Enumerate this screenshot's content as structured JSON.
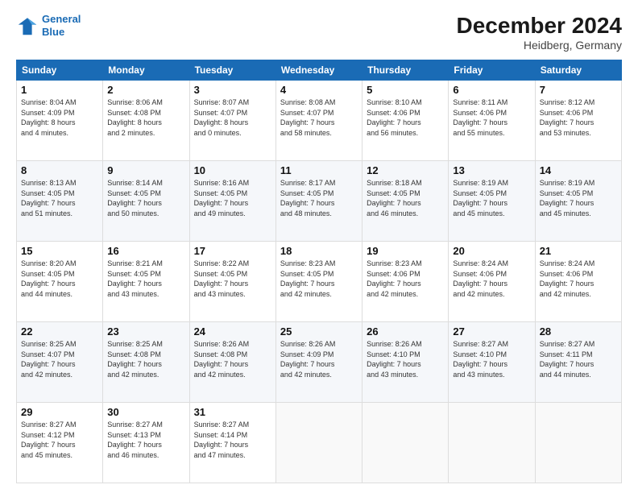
{
  "header": {
    "logo_line1": "General",
    "logo_line2": "Blue",
    "main_title": "December 2024",
    "subtitle": "Heidberg, Germany"
  },
  "days_of_week": [
    "Sunday",
    "Monday",
    "Tuesday",
    "Wednesday",
    "Thursday",
    "Friday",
    "Saturday"
  ],
  "weeks": [
    [
      {
        "day": "1",
        "info": "Sunrise: 8:04 AM\nSunset: 4:09 PM\nDaylight: 8 hours\nand 4 minutes."
      },
      {
        "day": "2",
        "info": "Sunrise: 8:06 AM\nSunset: 4:08 PM\nDaylight: 8 hours\nand 2 minutes."
      },
      {
        "day": "3",
        "info": "Sunrise: 8:07 AM\nSunset: 4:07 PM\nDaylight: 8 hours\nand 0 minutes."
      },
      {
        "day": "4",
        "info": "Sunrise: 8:08 AM\nSunset: 4:07 PM\nDaylight: 7 hours\nand 58 minutes."
      },
      {
        "day": "5",
        "info": "Sunrise: 8:10 AM\nSunset: 4:06 PM\nDaylight: 7 hours\nand 56 minutes."
      },
      {
        "day": "6",
        "info": "Sunrise: 8:11 AM\nSunset: 4:06 PM\nDaylight: 7 hours\nand 55 minutes."
      },
      {
        "day": "7",
        "info": "Sunrise: 8:12 AM\nSunset: 4:06 PM\nDaylight: 7 hours\nand 53 minutes."
      }
    ],
    [
      {
        "day": "8",
        "info": "Sunrise: 8:13 AM\nSunset: 4:05 PM\nDaylight: 7 hours\nand 51 minutes."
      },
      {
        "day": "9",
        "info": "Sunrise: 8:14 AM\nSunset: 4:05 PM\nDaylight: 7 hours\nand 50 minutes."
      },
      {
        "day": "10",
        "info": "Sunrise: 8:16 AM\nSunset: 4:05 PM\nDaylight: 7 hours\nand 49 minutes."
      },
      {
        "day": "11",
        "info": "Sunrise: 8:17 AM\nSunset: 4:05 PM\nDaylight: 7 hours\nand 48 minutes."
      },
      {
        "day": "12",
        "info": "Sunrise: 8:18 AM\nSunset: 4:05 PM\nDaylight: 7 hours\nand 46 minutes."
      },
      {
        "day": "13",
        "info": "Sunrise: 8:19 AM\nSunset: 4:05 PM\nDaylight: 7 hours\nand 45 minutes."
      },
      {
        "day": "14",
        "info": "Sunrise: 8:19 AM\nSunset: 4:05 PM\nDaylight: 7 hours\nand 45 minutes."
      }
    ],
    [
      {
        "day": "15",
        "info": "Sunrise: 8:20 AM\nSunset: 4:05 PM\nDaylight: 7 hours\nand 44 minutes."
      },
      {
        "day": "16",
        "info": "Sunrise: 8:21 AM\nSunset: 4:05 PM\nDaylight: 7 hours\nand 43 minutes."
      },
      {
        "day": "17",
        "info": "Sunrise: 8:22 AM\nSunset: 4:05 PM\nDaylight: 7 hours\nand 43 minutes."
      },
      {
        "day": "18",
        "info": "Sunrise: 8:23 AM\nSunset: 4:05 PM\nDaylight: 7 hours\nand 42 minutes."
      },
      {
        "day": "19",
        "info": "Sunrise: 8:23 AM\nSunset: 4:06 PM\nDaylight: 7 hours\nand 42 minutes."
      },
      {
        "day": "20",
        "info": "Sunrise: 8:24 AM\nSunset: 4:06 PM\nDaylight: 7 hours\nand 42 minutes."
      },
      {
        "day": "21",
        "info": "Sunrise: 8:24 AM\nSunset: 4:06 PM\nDaylight: 7 hours\nand 42 minutes."
      }
    ],
    [
      {
        "day": "22",
        "info": "Sunrise: 8:25 AM\nSunset: 4:07 PM\nDaylight: 7 hours\nand 42 minutes."
      },
      {
        "day": "23",
        "info": "Sunrise: 8:25 AM\nSunset: 4:08 PM\nDaylight: 7 hours\nand 42 minutes."
      },
      {
        "day": "24",
        "info": "Sunrise: 8:26 AM\nSunset: 4:08 PM\nDaylight: 7 hours\nand 42 minutes."
      },
      {
        "day": "25",
        "info": "Sunrise: 8:26 AM\nSunset: 4:09 PM\nDaylight: 7 hours\nand 42 minutes."
      },
      {
        "day": "26",
        "info": "Sunrise: 8:26 AM\nSunset: 4:10 PM\nDaylight: 7 hours\nand 43 minutes."
      },
      {
        "day": "27",
        "info": "Sunrise: 8:27 AM\nSunset: 4:10 PM\nDaylight: 7 hours\nand 43 minutes."
      },
      {
        "day": "28",
        "info": "Sunrise: 8:27 AM\nSunset: 4:11 PM\nDaylight: 7 hours\nand 44 minutes."
      }
    ],
    [
      {
        "day": "29",
        "info": "Sunrise: 8:27 AM\nSunset: 4:12 PM\nDaylight: 7 hours\nand 45 minutes."
      },
      {
        "day": "30",
        "info": "Sunrise: 8:27 AM\nSunset: 4:13 PM\nDaylight: 7 hours\nand 46 minutes."
      },
      {
        "day": "31",
        "info": "Sunrise: 8:27 AM\nSunset: 4:14 PM\nDaylight: 7 hours\nand 47 minutes."
      },
      {
        "day": "",
        "info": ""
      },
      {
        "day": "",
        "info": ""
      },
      {
        "day": "",
        "info": ""
      },
      {
        "day": "",
        "info": ""
      }
    ]
  ]
}
